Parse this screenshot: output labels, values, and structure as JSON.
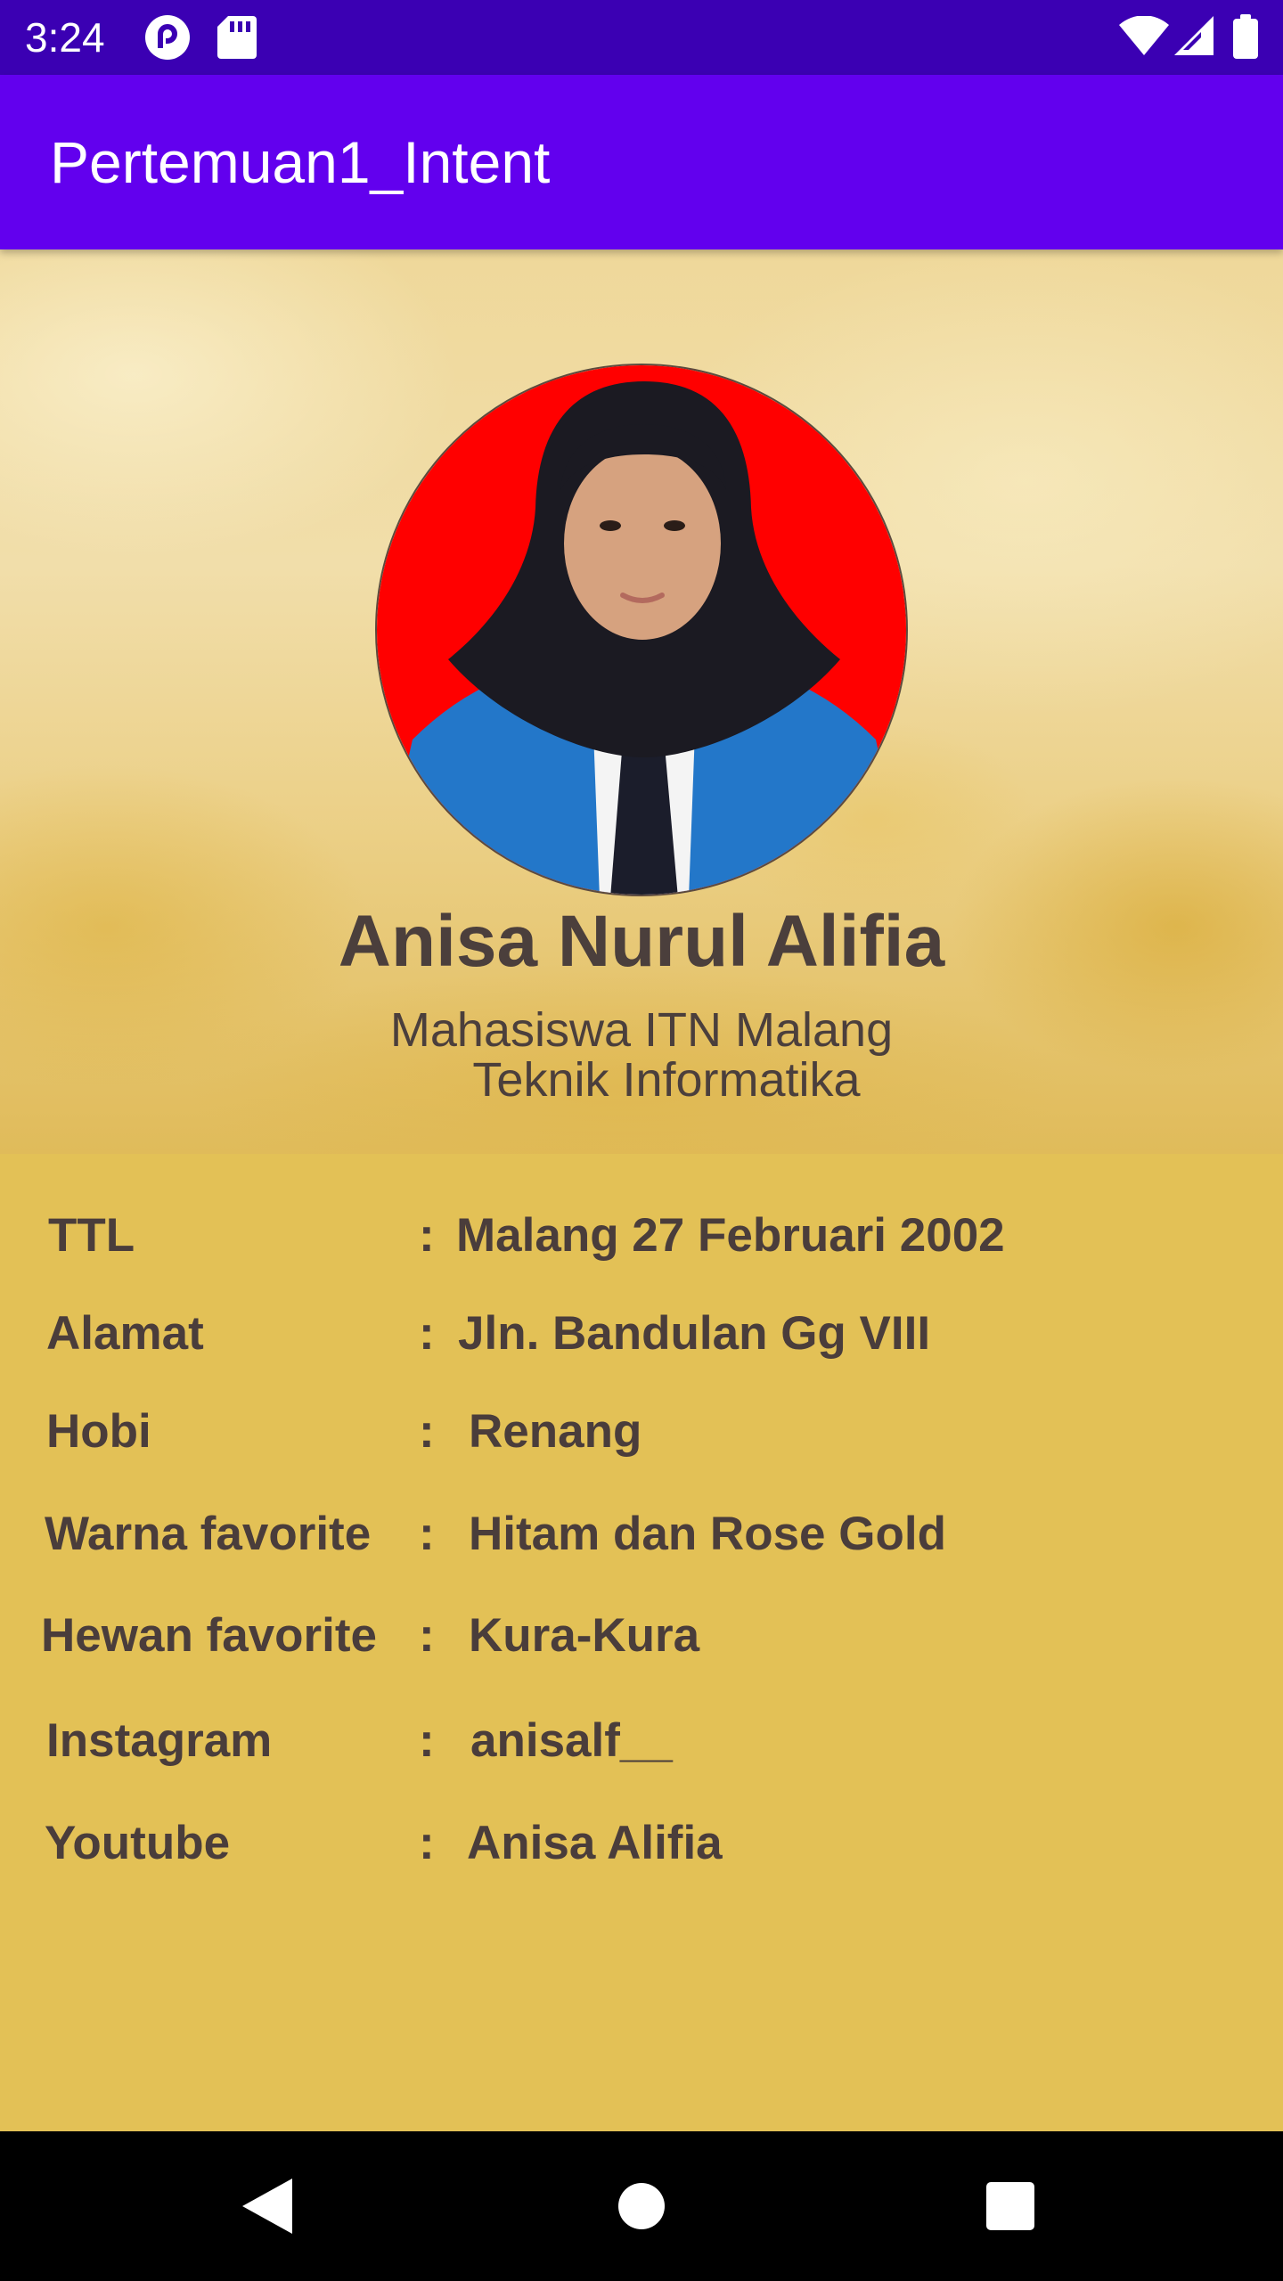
{
  "status_bar": {
    "time": "3:24",
    "left_icons": [
      "pocket-casts-icon",
      "sd-card-icon"
    ],
    "right_icons": [
      "wifi-icon",
      "signal-icon",
      "battery-icon"
    ]
  },
  "app_bar": {
    "title": "Pertemuan1_Intent",
    "color": "#6200ee"
  },
  "profile": {
    "name": "Anisa Nurul Alifia",
    "subtitle_line1": "Mahasiswa ITN Malang",
    "subtitle_line2": "Teknik Informatika",
    "photo_background": "#ff0000"
  },
  "details": {
    "background": "#e3c156",
    "rows": [
      {
        "label": "TTL",
        "colon": ":",
        "value": "Malang 27 Februari 2002"
      },
      {
        "label": "Alamat",
        "colon": ":",
        "value": "Jln. Bandulan Gg VIII"
      },
      {
        "label": "Hobi",
        "colon": ":",
        "value": "Renang"
      },
      {
        "label": "Warna favorite",
        "colon": ":",
        "value": "Hitam dan Rose Gold"
      },
      {
        "label": "Hewan favorite",
        "colon": ":",
        "value": "Kura-Kura"
      },
      {
        "label": "Instagram",
        "colon": ":",
        "value": "anisalf__"
      },
      {
        "label": "Youtube",
        "colon": ":",
        "value": "Anisa Alifia"
      }
    ]
  },
  "nav_bar": {
    "buttons": [
      "back-icon",
      "home-icon",
      "recents-icon"
    ]
  }
}
